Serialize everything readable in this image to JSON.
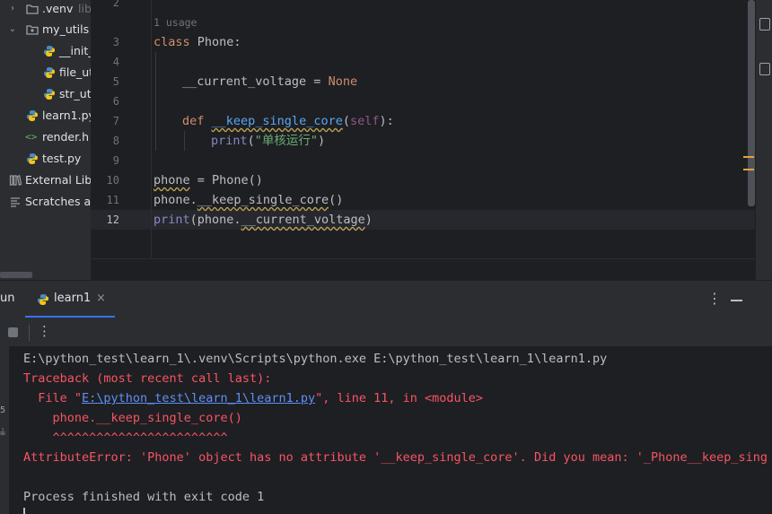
{
  "project_tree": {
    "items": [
      {
        "label": ".venv",
        "suffix": "lib",
        "icon": "folder-icon",
        "expanded": false
      },
      {
        "label": "my_utils",
        "icon": "package-folder-icon",
        "expanded": true
      },
      {
        "label": "__init_",
        "icon": "python-file-icon"
      },
      {
        "label": "file_ut",
        "icon": "python-file-icon"
      },
      {
        "label": "str_ut",
        "icon": "python-file-icon"
      },
      {
        "label": "learn1.py",
        "icon": "python-file-icon"
      },
      {
        "label": "render.h",
        "icon": "html-file-icon"
      },
      {
        "label": "test.py",
        "icon": "python-file-icon"
      },
      {
        "label": "External Lib",
        "icon": "library-icon"
      },
      {
        "label": "Scratches a",
        "icon": "scratches-icon"
      }
    ]
  },
  "editor": {
    "usage_hint": "1 usage",
    "line_numbers": [
      "2",
      "3",
      "4",
      "5",
      "6",
      "7",
      "8",
      "9",
      "10",
      "11",
      "12"
    ],
    "current_line": "12",
    "code": {
      "l3_kw": "class",
      "l3_name": " Phone:",
      "l5_var": "__current_voltage",
      "l5_eq": " = ",
      "l5_none": "None",
      "l7_def": "def",
      "l7_name": "__keep_single_core",
      "l7_open": "(",
      "l7_self": "self",
      "l7_close": "):",
      "l8_print": "print",
      "l8_open": "(",
      "l8_str": "\"单核运行\"",
      "l8_close": ")",
      "l10_var": "phone",
      "l10_rest": " = Phone()",
      "l11_obj": "phone.",
      "l11_call": "__keep_single_core",
      "l11_end": "()",
      "l12_print": "print",
      "l12_mid": "(phone.",
      "l12_attr": "__current_voltage",
      "l12_end": ")"
    }
  },
  "run_panel": {
    "title_fragment": "un",
    "tab_label": "learn1",
    "tab_close": "×",
    "more": "⋮",
    "toolbar_more": "⋮"
  },
  "console": {
    "line1": "E:\\python_test\\learn_1\\.venv\\Scripts\\python.exe E:\\python_test\\learn_1\\learn1.py",
    "line2": "Traceback (most recent call last):",
    "line3_prefix": "  File \"",
    "line3_link": "E:\\python_test\\learn_1\\learn1.py",
    "line3_suffix": "\", line 11, in <module>",
    "line4": "    phone.__keep_single_core()",
    "line5": "    ^^^^^^^^^^^^^^^^^^^^^^^^",
    "line6": "AttributeError: 'Phone' object has no attribute '__keep_single_core'. Did you mean: '_Phone__keep_sing",
    "line8": "Process finished with exit code 1",
    "gutter_glyphs": [
      "5",
      "≟"
    ]
  },
  "colors": {
    "keyword": "#cf8e6d",
    "function": "#56a8f5",
    "string": "#6aab73",
    "error": "#f75464",
    "link": "#5e8ff6",
    "accent": "#3574f0"
  }
}
